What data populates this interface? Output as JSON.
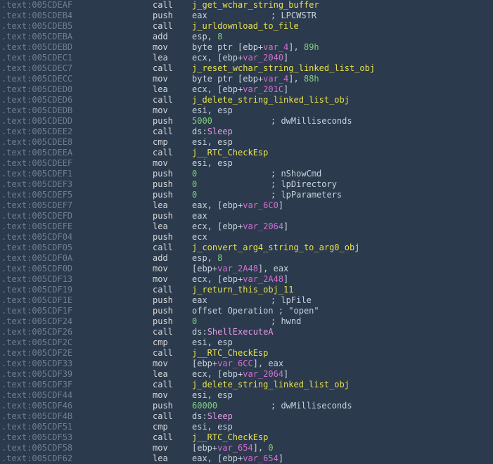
{
  "colors": {
    "background": "#2b3a4c",
    "address": "#6f7f93",
    "mnemonic": "#d8d8d8",
    "operand": "#c8d3de",
    "function_name": "#e6e14e",
    "number": "#7fd07f",
    "variable": "#d36fd3",
    "api_import": "#e59be5"
  },
  "lines": [
    {
      "addr": ".text:005CDEAF",
      "mn": "call",
      "ops": [
        {
          "t": "func",
          "v": "j_get_wchar_string_buffer"
        }
      ],
      "comment": ""
    },
    {
      "addr": ".text:005CDEB4",
      "mn": "push",
      "ops": [
        {
          "t": "reg",
          "v": "eax"
        }
      ],
      "comment": "; LPCWSTR"
    },
    {
      "addr": ".text:005CDEB5",
      "mn": "call",
      "ops": [
        {
          "t": "func",
          "v": "j_urldownload_to_file"
        }
      ],
      "comment": ""
    },
    {
      "addr": ".text:005CDEBA",
      "mn": "add",
      "ops": [
        {
          "t": "reg",
          "v": "esp, "
        },
        {
          "t": "num",
          "v": "8"
        }
      ],
      "comment": ""
    },
    {
      "addr": ".text:005CDEBD",
      "mn": "mov",
      "ops": [
        {
          "t": "plain",
          "v": "byte ptr [ebp+"
        },
        {
          "t": "var",
          "v": "var_4"
        },
        {
          "t": "plain",
          "v": "], "
        },
        {
          "t": "num",
          "v": "89h"
        }
      ],
      "comment": ""
    },
    {
      "addr": ".text:005CDEC1",
      "mn": "lea",
      "ops": [
        {
          "t": "plain",
          "v": "ecx, [ebp+"
        },
        {
          "t": "var",
          "v": "var_2040"
        },
        {
          "t": "plain",
          "v": "]"
        }
      ],
      "comment": ""
    },
    {
      "addr": ".text:005CDEC7",
      "mn": "call",
      "ops": [
        {
          "t": "func",
          "v": "j_reset_wchar_string_linked_list_obj"
        }
      ],
      "comment": ""
    },
    {
      "addr": ".text:005CDECC",
      "mn": "mov",
      "ops": [
        {
          "t": "plain",
          "v": "byte ptr [ebp+"
        },
        {
          "t": "var",
          "v": "var_4"
        },
        {
          "t": "plain",
          "v": "], "
        },
        {
          "t": "num",
          "v": "88h"
        }
      ],
      "comment": ""
    },
    {
      "addr": ".text:005CDED0",
      "mn": "lea",
      "ops": [
        {
          "t": "plain",
          "v": "ecx, [ebp+"
        },
        {
          "t": "var",
          "v": "var_201C"
        },
        {
          "t": "plain",
          "v": "]"
        }
      ],
      "comment": ""
    },
    {
      "addr": ".text:005CDED6",
      "mn": "call",
      "ops": [
        {
          "t": "func",
          "v": "j_delete_string_linked_list_obj"
        }
      ],
      "comment": ""
    },
    {
      "addr": ".text:005CDEDB",
      "mn": "mov",
      "ops": [
        {
          "t": "reg",
          "v": "esi, esp"
        }
      ],
      "comment": ""
    },
    {
      "addr": ".text:005CDEDD",
      "mn": "push",
      "ops": [
        {
          "t": "num",
          "v": "5000"
        }
      ],
      "comment": "; dwMilliseconds"
    },
    {
      "addr": ".text:005CDEE2",
      "mn": "call",
      "ops": [
        {
          "t": "plain",
          "v": "ds:"
        },
        {
          "t": "api",
          "v": "Sleep"
        }
      ],
      "comment": ""
    },
    {
      "addr": ".text:005CDEE8",
      "mn": "cmp",
      "ops": [
        {
          "t": "reg",
          "v": "esi, esp"
        }
      ],
      "comment": ""
    },
    {
      "addr": ".text:005CDEEA",
      "mn": "call",
      "ops": [
        {
          "t": "func",
          "v": "j__RTC_CheckEsp"
        }
      ],
      "comment": ""
    },
    {
      "addr": ".text:005CDEEF",
      "mn": "mov",
      "ops": [
        {
          "t": "reg",
          "v": "esi, esp"
        }
      ],
      "comment": ""
    },
    {
      "addr": ".text:005CDEF1",
      "mn": "push",
      "ops": [
        {
          "t": "num",
          "v": "0"
        }
      ],
      "comment": "; nShowCmd"
    },
    {
      "addr": ".text:005CDEF3",
      "mn": "push",
      "ops": [
        {
          "t": "num",
          "v": "0"
        }
      ],
      "comment": "; lpDirectory"
    },
    {
      "addr": ".text:005CDEF5",
      "mn": "push",
      "ops": [
        {
          "t": "num",
          "v": "0"
        }
      ],
      "comment": "; lpParameters"
    },
    {
      "addr": ".text:005CDEF7",
      "mn": "lea",
      "ops": [
        {
          "t": "plain",
          "v": "eax, [ebp+"
        },
        {
          "t": "var",
          "v": "var_6C0"
        },
        {
          "t": "plain",
          "v": "]"
        }
      ],
      "comment": ""
    },
    {
      "addr": ".text:005CDEFD",
      "mn": "push",
      "ops": [
        {
          "t": "reg",
          "v": "eax"
        }
      ],
      "comment": ""
    },
    {
      "addr": ".text:005CDEFE",
      "mn": "lea",
      "ops": [
        {
          "t": "plain",
          "v": "ecx, [ebp+"
        },
        {
          "t": "var",
          "v": "var_2064"
        },
        {
          "t": "plain",
          "v": "]"
        }
      ],
      "comment": ""
    },
    {
      "addr": ".text:005CDF04",
      "mn": "push",
      "ops": [
        {
          "t": "reg",
          "v": "ecx"
        }
      ],
      "comment": ""
    },
    {
      "addr": ".text:005CDF05",
      "mn": "call",
      "ops": [
        {
          "t": "func",
          "v": "j_convert_arg4_string_to_arg0_obj"
        }
      ],
      "comment": ""
    },
    {
      "addr": ".text:005CDF0A",
      "mn": "add",
      "ops": [
        {
          "t": "reg",
          "v": "esp, "
        },
        {
          "t": "num",
          "v": "8"
        }
      ],
      "comment": ""
    },
    {
      "addr": ".text:005CDF0D",
      "mn": "mov",
      "ops": [
        {
          "t": "plain",
          "v": "[ebp+"
        },
        {
          "t": "var",
          "v": "var_2A48"
        },
        {
          "t": "plain",
          "v": "], eax"
        }
      ],
      "comment": ""
    },
    {
      "addr": ".text:005CDF13",
      "mn": "mov",
      "ops": [
        {
          "t": "plain",
          "v": "ecx, [ebp+"
        },
        {
          "t": "var",
          "v": "var_2A48"
        },
        {
          "t": "plain",
          "v": "]"
        }
      ],
      "comment": ""
    },
    {
      "addr": ".text:005CDF19",
      "mn": "call",
      "ops": [
        {
          "t": "func",
          "v": "j_return_this_obj_11"
        }
      ],
      "comment": ""
    },
    {
      "addr": ".text:005CDF1E",
      "mn": "push",
      "ops": [
        {
          "t": "reg",
          "v": "eax"
        }
      ],
      "comment": "; lpFile"
    },
    {
      "addr": ".text:005CDF1F",
      "mn": "push",
      "ops": [
        {
          "t": "plain",
          "v": "offset Operation ; \"open\""
        }
      ],
      "comment": ""
    },
    {
      "addr": ".text:005CDF24",
      "mn": "push",
      "ops": [
        {
          "t": "num",
          "v": "0"
        }
      ],
      "comment": "; hwnd"
    },
    {
      "addr": ".text:005CDF26",
      "mn": "call",
      "ops": [
        {
          "t": "plain",
          "v": "ds:"
        },
        {
          "t": "api",
          "v": "ShellExecuteA"
        }
      ],
      "comment": ""
    },
    {
      "addr": ".text:005CDF2C",
      "mn": "cmp",
      "ops": [
        {
          "t": "reg",
          "v": "esi, esp"
        }
      ],
      "comment": ""
    },
    {
      "addr": ".text:005CDF2E",
      "mn": "call",
      "ops": [
        {
          "t": "func",
          "v": "j__RTC_CheckEsp"
        }
      ],
      "comment": ""
    },
    {
      "addr": ".text:005CDF33",
      "mn": "mov",
      "ops": [
        {
          "t": "plain",
          "v": "[ebp+"
        },
        {
          "t": "var",
          "v": "var_6CC"
        },
        {
          "t": "plain",
          "v": "], eax"
        }
      ],
      "comment": ""
    },
    {
      "addr": ".text:005CDF39",
      "mn": "lea",
      "ops": [
        {
          "t": "plain",
          "v": "ecx, [ebp+"
        },
        {
          "t": "var",
          "v": "var_2064"
        },
        {
          "t": "plain",
          "v": "]"
        }
      ],
      "comment": ""
    },
    {
      "addr": ".text:005CDF3F",
      "mn": "call",
      "ops": [
        {
          "t": "func",
          "v": "j_delete_string_linked_list_obj"
        }
      ],
      "comment": ""
    },
    {
      "addr": ".text:005CDF44",
      "mn": "mov",
      "ops": [
        {
          "t": "reg",
          "v": "esi, esp"
        }
      ],
      "comment": ""
    },
    {
      "addr": ".text:005CDF46",
      "mn": "push",
      "ops": [
        {
          "t": "num",
          "v": "60000"
        }
      ],
      "comment": "; dwMilliseconds"
    },
    {
      "addr": ".text:005CDF4B",
      "mn": "call",
      "ops": [
        {
          "t": "plain",
          "v": "ds:"
        },
        {
          "t": "api",
          "v": "Sleep"
        }
      ],
      "comment": ""
    },
    {
      "addr": ".text:005CDF51",
      "mn": "cmp",
      "ops": [
        {
          "t": "reg",
          "v": "esi, esp"
        }
      ],
      "comment": ""
    },
    {
      "addr": ".text:005CDF53",
      "mn": "call",
      "ops": [
        {
          "t": "func",
          "v": "j__RTC_CheckEsp"
        }
      ],
      "comment": ""
    },
    {
      "addr": ".text:005CDF58",
      "mn": "mov",
      "ops": [
        {
          "t": "plain",
          "v": "[ebp+"
        },
        {
          "t": "var",
          "v": "var_654"
        },
        {
          "t": "plain",
          "v": "], "
        },
        {
          "t": "num",
          "v": "0"
        }
      ],
      "comment": ""
    },
    {
      "addr": ".text:005CDF62",
      "mn": "lea",
      "ops": [
        {
          "t": "plain",
          "v": "eax, [ebp+"
        },
        {
          "t": "var",
          "v": "var_654"
        },
        {
          "t": "plain",
          "v": "]"
        }
      ],
      "comment": ""
    }
  ]
}
